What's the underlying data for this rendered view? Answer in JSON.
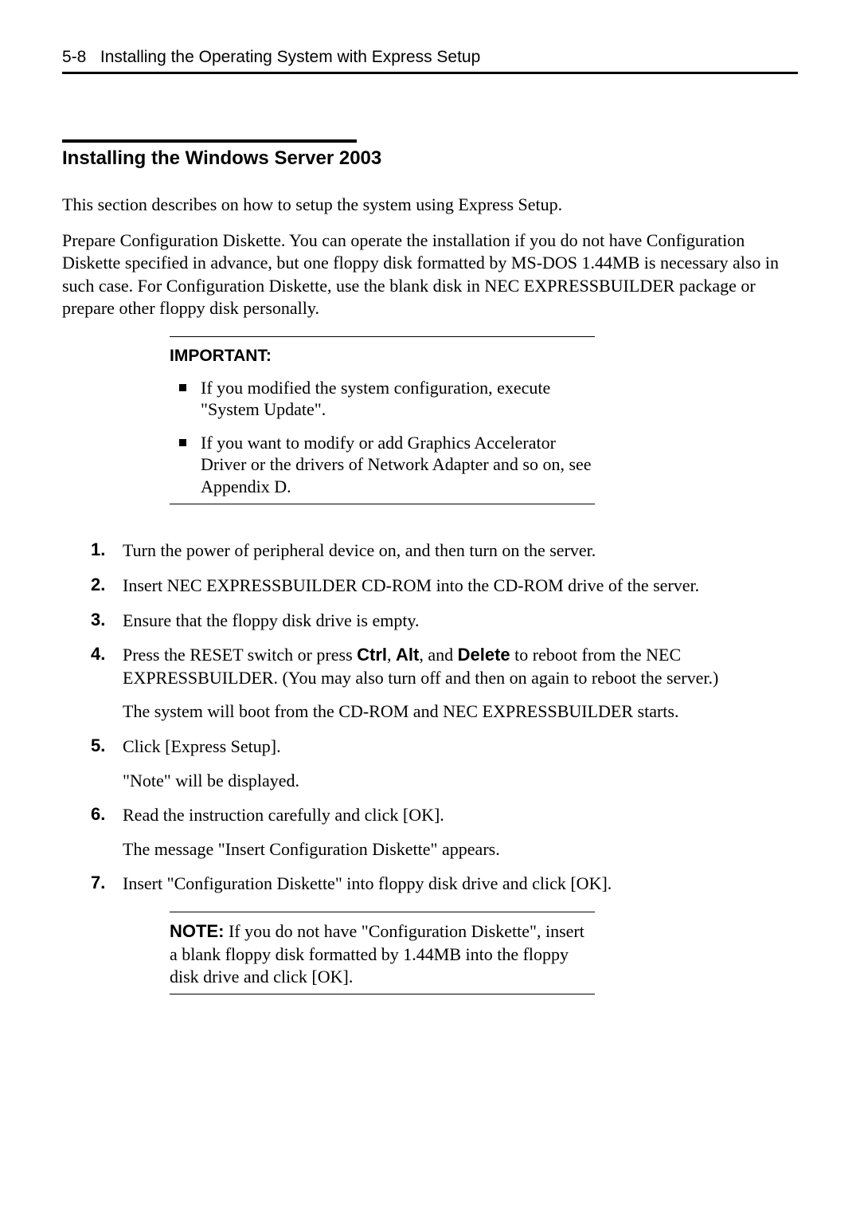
{
  "header": {
    "page_num": "5-8",
    "title": "Installing the Operating System with Express Setup"
  },
  "section": {
    "title": "Installing the Windows Server 2003",
    "intro1": "This section describes on how to setup the system using Express Setup.",
    "intro2": "Prepare Configuration Diskette.    You can operate the installation if you do not have Configuration Diskette specified in advance, but one floppy disk formatted by MS-DOS 1.44MB is necessary also in such case.    For Configuration Diskette, use the blank disk in NEC EXPRESSBUILDER package or prepare other floppy disk personally."
  },
  "important": {
    "label": "IMPORTANT:",
    "items": [
      "If you modified the system configuration, execute \"System Update\".",
      "If you want to modify or add Graphics Accelerator Driver or the drivers of Network Adapter and so on, see Appendix D."
    ]
  },
  "steps": [
    {
      "num": "1.",
      "paras": [
        "Turn the power of peripheral device on, and then turn on the server."
      ]
    },
    {
      "num": "2.",
      "paras": [
        "Insert NEC EXPRESSBUILDER CD-ROM into the CD-ROM drive of the server."
      ]
    },
    {
      "num": "3.",
      "paras": [
        "Ensure that the floppy disk drive is empty."
      ]
    },
    {
      "num": "4.",
      "key_pre": "Press the RESET switch or press ",
      "k1": "Ctrl",
      "c1": ", ",
      "k2": "Alt",
      "c2": ", and ",
      "k3": "Delete",
      "key_post": " to reboot from the NEC EXPRESSBUILDER.    (You may also turn off and then on again to reboot the server.)",
      "para2": "The system will boot from the CD-ROM and NEC EXPRESSBUILDER starts."
    },
    {
      "num": "5.",
      "paras": [
        "Click [Express Setup].",
        "\"Note\" will be displayed."
      ]
    },
    {
      "num": "6.",
      "paras": [
        "Read the instruction carefully and click [OK].",
        "The message \"Insert Configuration Diskette\" appears."
      ]
    },
    {
      "num": "7.",
      "paras": [
        "Insert \"Configuration Diskette\" into floppy disk drive and click [OK]."
      ]
    }
  ],
  "note": {
    "label": "NOTE:",
    "text": " If you do not have \"Configuration Diskette\", insert a blank floppy disk formatted by 1.44MB into the floppy disk drive and click [OK]."
  }
}
